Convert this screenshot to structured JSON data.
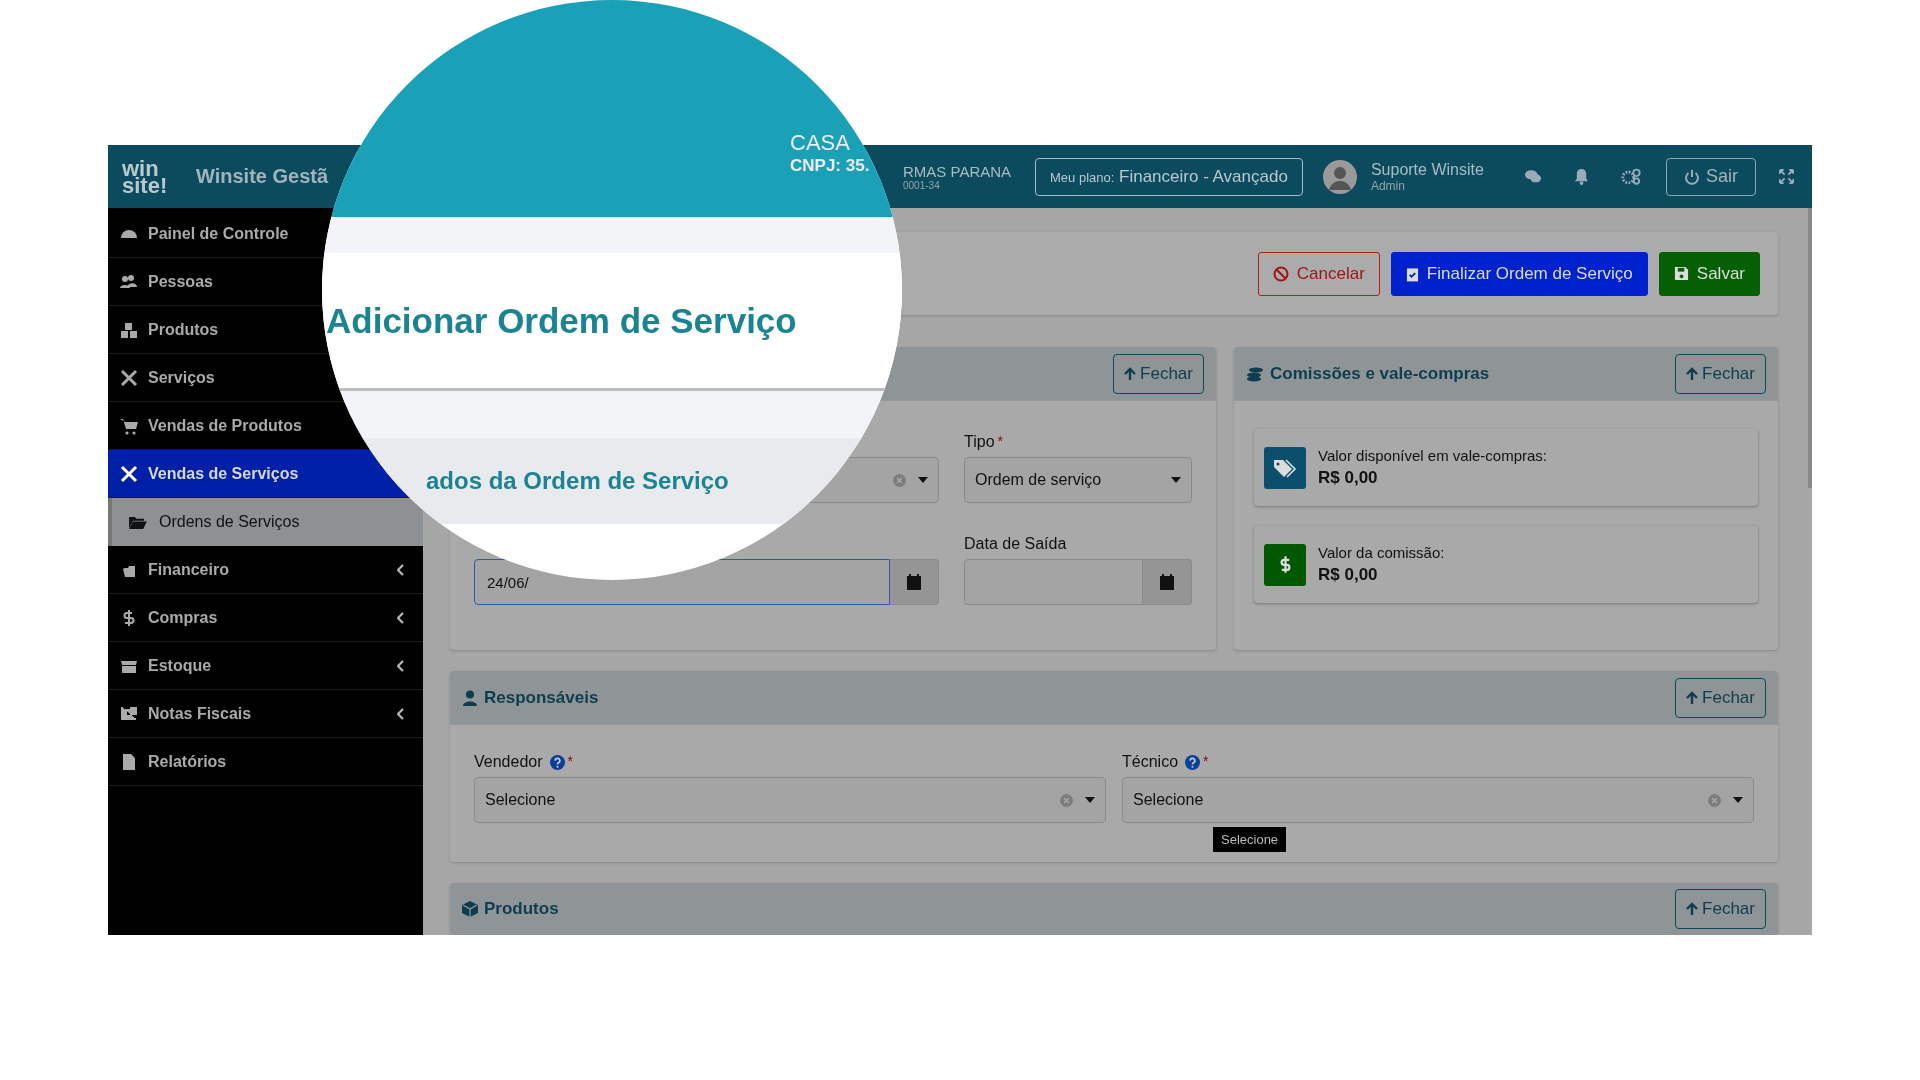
{
  "header": {
    "logo_lines": [
      "win",
      "site!"
    ],
    "app_name": "Winsite Gestã",
    "company": "RMAS PARANA",
    "company_id": "0001-34",
    "plan_label": "Meu plano:",
    "plan": "Financeiro - Avançado",
    "user": "Suporte Winsite",
    "role": "Admin",
    "logout": "Sair"
  },
  "magnifier": {
    "company": "CASA",
    "cnpj": "CNPJ: 35.",
    "title": "Adicionar Ordem de Serviço",
    "section": "ados da Ordem de Serviço"
  },
  "sidebar": [
    {
      "label": "Painel de Controle",
      "selected": false,
      "has_submenu": false
    },
    {
      "label": "Pessoas",
      "selected": false,
      "has_submenu": false
    },
    {
      "label": "Produtos",
      "selected": false,
      "has_submenu": false
    },
    {
      "label": "Serviços",
      "selected": false,
      "has_submenu": false
    },
    {
      "label": "Vendas de Produtos",
      "selected": false,
      "has_submenu": false
    },
    {
      "label": "Vendas de Serviços",
      "selected": true,
      "has_submenu": false,
      "expanded": true,
      "children": [
        {
          "label": "Ordens de Serviços",
          "selected": false
        }
      ]
    },
    {
      "label": "Financeiro",
      "selected": false,
      "has_submenu": true
    },
    {
      "label": "Compras",
      "selected": false,
      "has_submenu": true
    },
    {
      "label": "Estoque",
      "selected": false,
      "has_submenu": true
    },
    {
      "label": "Notas Fiscais",
      "selected": false,
      "has_submenu": true
    },
    {
      "label": "Relatórios",
      "selected": false,
      "has_submenu": false
    }
  ],
  "actions": [
    {
      "label": "Cancelar",
      "kind": "cancel"
    },
    {
      "label": "Finalizar Ordem de Serviço",
      "kind": "finish"
    },
    {
      "label": "Salvar",
      "kind": "save"
    }
  ],
  "order_panel": {
    "close": "Fechar",
    "type_label": "Tipo",
    "type_mark": "*",
    "type_value": "Ordem de serviço",
    "entry_date": "24/06/",
    "exit_label": "Data de Saída"
  },
  "commissions": {
    "title": "Comissões e vale-compras",
    "close": "Fechar",
    "cards": [
      {
        "kind": "voucher",
        "label": "Valor disponível em vale-compras:",
        "value": "R$ 0,00"
      },
      {
        "kind": "commission",
        "label": "Valor da comissão:",
        "value": "R$ 0,00"
      }
    ]
  },
  "responsibles": {
    "title": "Responsáveis",
    "close": "Fechar",
    "fields": [
      {
        "label": "Vendedor",
        "mark": "*",
        "value": "Selecione"
      },
      {
        "label": "Técnico",
        "mark": "*",
        "value": "Selecione"
      }
    ],
    "tooltip": "Selecione"
  },
  "products": {
    "title": "Produtos",
    "close": "Fechar"
  }
}
